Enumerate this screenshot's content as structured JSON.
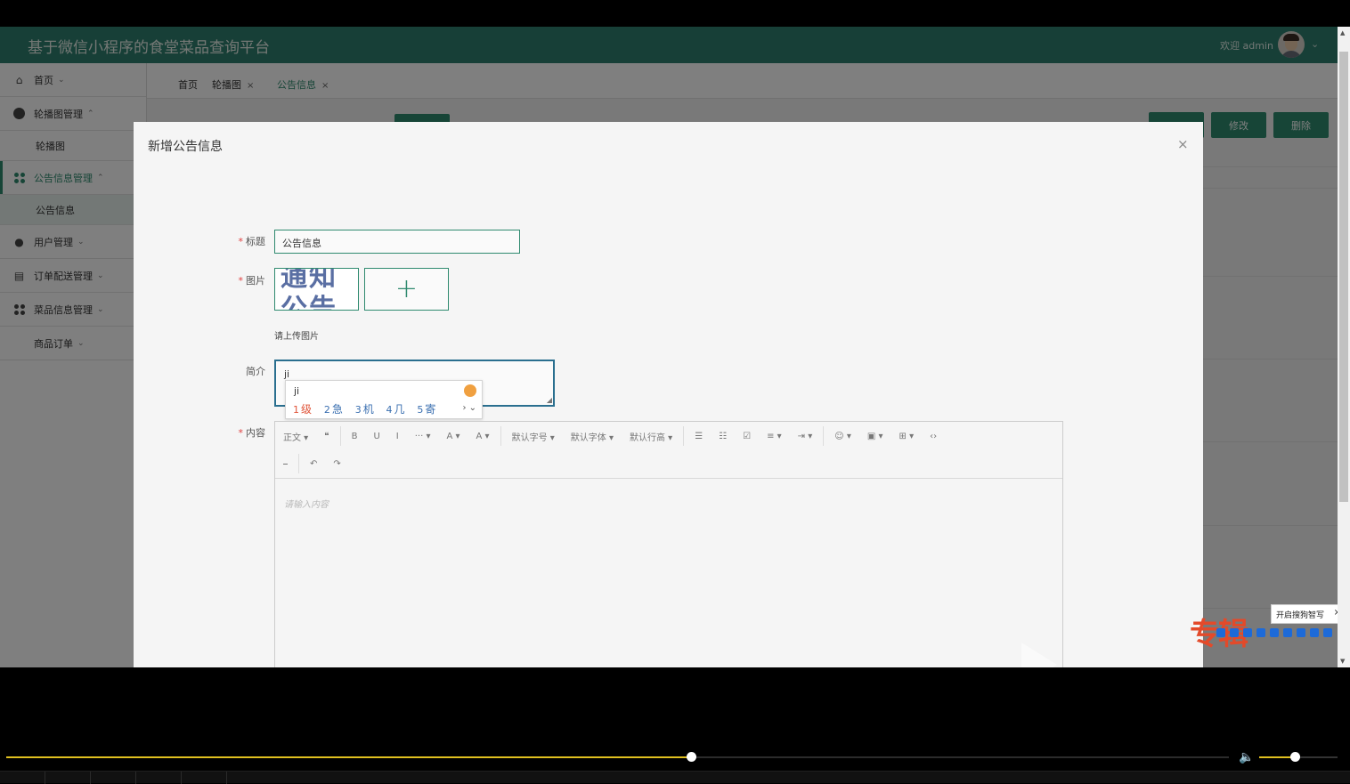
{
  "header": {
    "title": "基于微信小程序的食堂菜品查询平台",
    "welcome": "欢迎 admin"
  },
  "sidebar": {
    "items": [
      {
        "label": "首页",
        "icon": "home-icon",
        "chevron": "⌄"
      },
      {
        "label": "轮播图管理",
        "icon": "carousel-icon",
        "chevron": "⌃"
      },
      {
        "label": "轮播图",
        "sub": true
      },
      {
        "label": "公告信息管理",
        "icon": "grid-icon",
        "chevron": "⌃"
      },
      {
        "label": "公告信息",
        "sub": true
      },
      {
        "label": "用户管理",
        "icon": "user-icon",
        "chevron": "⌄"
      },
      {
        "label": "订单配送管理",
        "icon": "list-icon",
        "chevron": "⌄"
      },
      {
        "label": "菜品信息管理",
        "icon": "grid-icon",
        "chevron": "⌄"
      },
      {
        "label": "商品订单",
        "icon": "",
        "chevron": "⌄"
      }
    ]
  },
  "tabs": [
    {
      "label": "首页"
    },
    {
      "label": "轮播图",
      "close": "×"
    },
    {
      "label": "公告信息",
      "close": "×"
    }
  ],
  "background_buttons": {
    "edit": "修改",
    "delete": "删除"
  },
  "modal": {
    "title": "新增公告信息",
    "close": "×",
    "form": {
      "title_label": "标题",
      "title_value": "公告信息",
      "image_label": "图片",
      "image_thumb_text_line1": "通知",
      "image_thumb_text_line2": "公告",
      "upload_plus": "+",
      "upload_hint": "请上传图片",
      "intro_label": "简介",
      "intro_value": "ji",
      "content_label": "内容",
      "required_mark": "*"
    },
    "ime": {
      "composition": "ji",
      "candidates": [
        {
          "num": "1",
          "text": "级"
        },
        {
          "num": "2",
          "text": "急"
        },
        {
          "num": "3",
          "text": "机"
        },
        {
          "num": "4",
          "text": "几"
        },
        {
          "num": "5",
          "text": "寄"
        }
      ],
      "more": "› ⌄"
    },
    "editor": {
      "toolbar_row1": [
        "正文 ▾",
        "❝",
        "B",
        "U",
        "I",
        "··· ▾",
        "A ▾",
        "A ▾",
        "默认字号 ▾",
        "默认字体 ▾",
        "默认行高 ▾",
        "☰",
        "☷",
        "☑",
        "≡ ▾",
        "⇥ ▾",
        "☺ ▾",
        "▣ ▾",
        "⊞ ▾",
        "‹›"
      ],
      "toolbar_row2": [
        "⎯",
        "↶",
        "↷"
      ],
      "placeholder": "请输入内容"
    }
  },
  "sogou": {
    "tip": "开启搜狗智写",
    "close": "×",
    "brand": "专辑"
  },
  "player": {
    "progress": 0.56,
    "volume": 0.45
  },
  "colors": {
    "header": "#2f7f6f",
    "accent": "#2f8a6f",
    "progress": "#e0c020"
  }
}
